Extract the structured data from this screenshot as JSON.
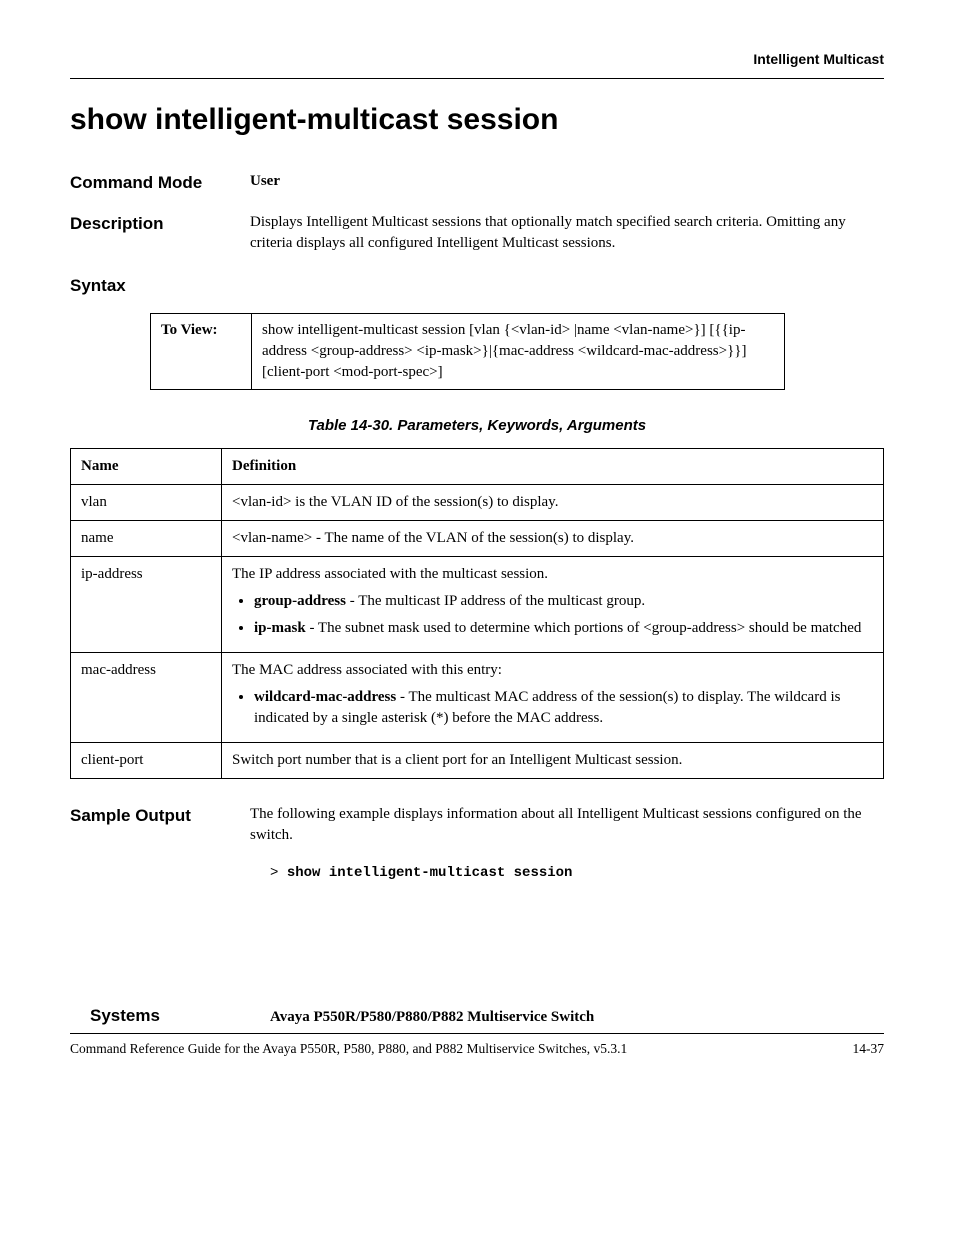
{
  "header": {
    "section": "Intelligent Multicast"
  },
  "title": "show intelligent-multicast session",
  "commandMode": {
    "label": "Command Mode",
    "value": "User"
  },
  "description": {
    "label": "Description",
    "value": "Displays Intelligent Multicast sessions that optionally match specified search criteria. Omitting any criteria displays all configured Intelligent Multicast sessions."
  },
  "syntax": {
    "label": "Syntax",
    "tableLabel": "To View:",
    "tableValue": "show intelligent-multicast session [vlan {<vlan-id> |name <vlan-name>}] [{{ip-address <group-address> <ip-mask>}|{mac-address <wildcard-mac-address>}}] [client-port <mod-port-spec>]"
  },
  "paramTable": {
    "caption": "Table 14-30.  Parameters, Keywords, Arguments",
    "headers": {
      "name": "Name",
      "definition": "Definition"
    },
    "rows": [
      {
        "name": "vlan",
        "definition": "<vlan-id> is the VLAN ID of the session(s) to display."
      },
      {
        "name": "name",
        "definition": "<vlan-name> - The name of the VLAN of the session(s) to display."
      },
      {
        "name": "ip-address",
        "definition": "The IP address associated with the multicast session.",
        "bullets": [
          {
            "term": "group-address",
            "text": " - The multicast IP address of the multicast group."
          },
          {
            "term": "ip-mask",
            "text": " - The subnet mask used to determine which portions of <group-address> should be matched"
          }
        ]
      },
      {
        "name": "mac-address",
        "definition": "The MAC address associated with this entry:",
        "bullets": [
          {
            "term": "wildcard-mac-address",
            "text": " - The multicast MAC address of the session(s) to display. The wildcard is indicated by a single asterisk (*) before the MAC address."
          }
        ]
      },
      {
        "name": "client-port",
        "definition": "Switch port number that is a client port for an Intelligent Multicast session."
      }
    ]
  },
  "sampleOutput": {
    "label": "Sample Output",
    "text": "The following example displays information about all Intelligent Multicast sessions configured on the switch.",
    "prompt": "> ",
    "command": "show intelligent-multicast session"
  },
  "systems": {
    "label": "Systems",
    "value": "Avaya P550R/P580/P880/P882 Multiservice Switch"
  },
  "footer": {
    "left": "Command Reference Guide for the Avaya P550R, P580, P880, and P882 Multiservice Switches, v5.3.1",
    "right": "14-37"
  }
}
